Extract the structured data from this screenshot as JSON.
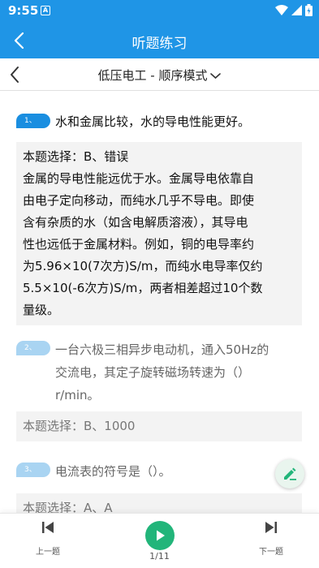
{
  "status_bar": {
    "time": "9:55",
    "notification_letter": "A"
  },
  "app_bar": {
    "title": "听题练习"
  },
  "sub_bar": {
    "title": "低压电工 - 顺序模式"
  },
  "colors": {
    "primary": "#1f95e6",
    "badge_active": "#1a8ee0",
    "badge_inactive": "#a9d4f2",
    "play": "#22b57a"
  },
  "questions": [
    {
      "badge": "1、",
      "text": "水和金属比较，水的导电性能更好。",
      "answer_lines": [
        "本题选择：B、错误",
        "金属的导电性能远优于水。金属导电依靠自",
        "由电子定向移动，而纯水几乎不导电。即使",
        "含有杂质的水（如含电解质溶液），其导电",
        "性也远低于金属材料。例如，铜的电导率约",
        "为5.96×10(7次方)S/m，而纯水电导率仅约",
        "5.5×10(-6次方)S/m，两者相差超过10个数",
        "量级。"
      ]
    },
    {
      "badge": "2、",
      "text_lines": [
        "一台六极三相异步电动机，通入50Hz的",
        "交流电，其定子旋转磁场转速为（）",
        "r/min。"
      ],
      "answer": "本题选择：B、1000"
    },
    {
      "badge": "3、",
      "text": "电流表的符号是（）。",
      "answer": "本题选择：A、A"
    }
  ],
  "bottom_bar": {
    "prev_label": "上一题",
    "next_label": "下一题",
    "page_indicator": "1/11"
  }
}
